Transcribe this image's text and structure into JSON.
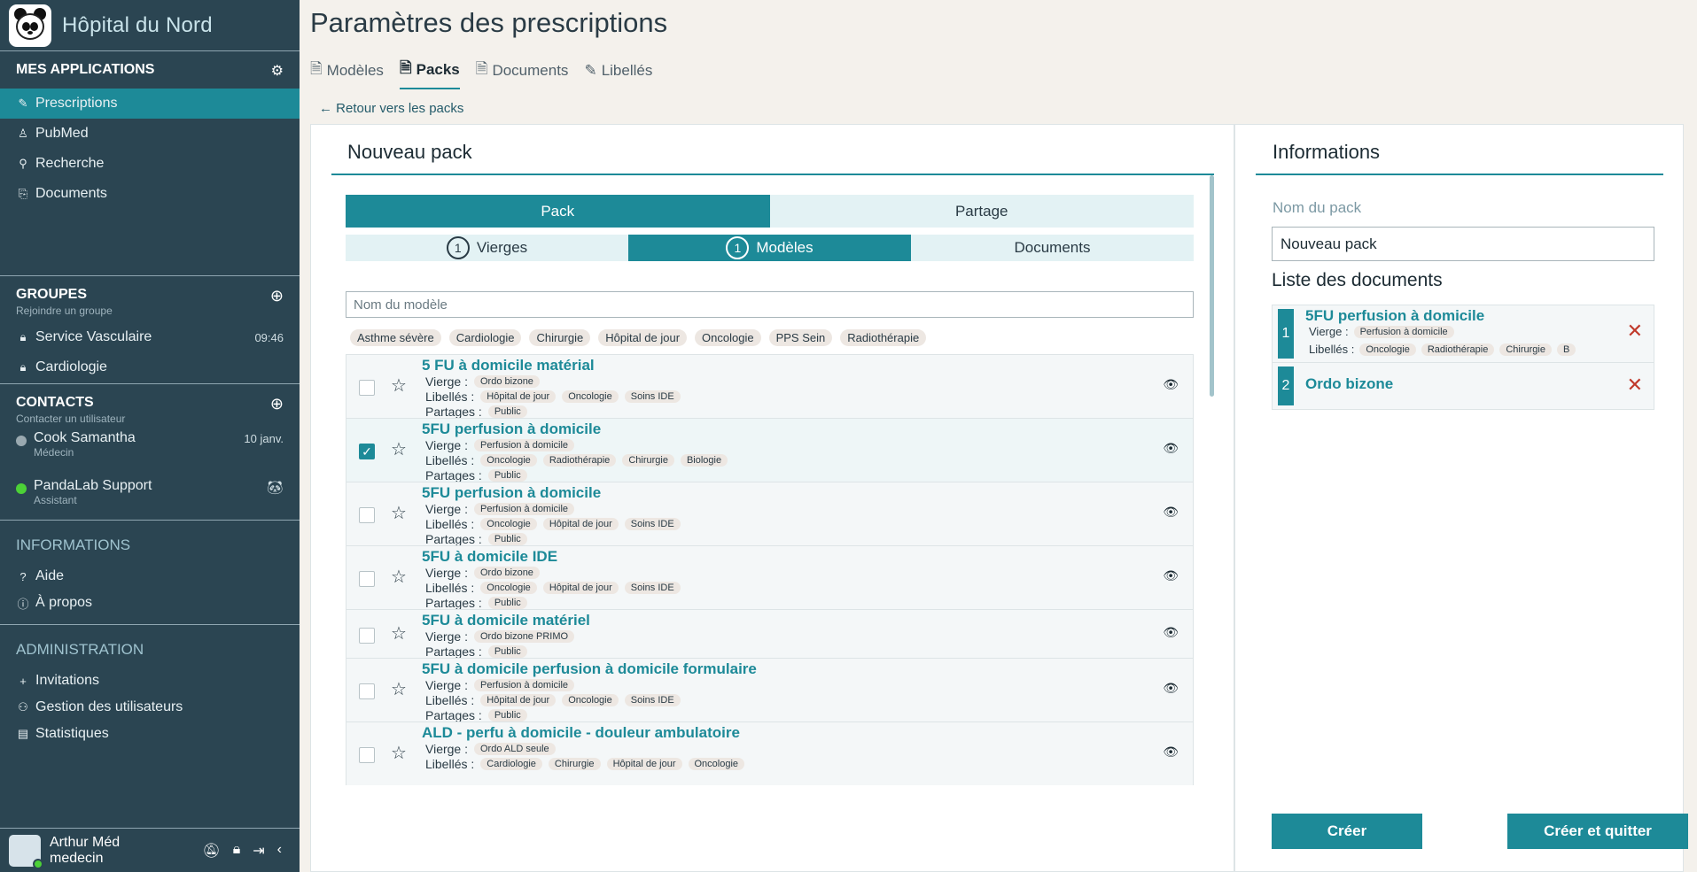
{
  "sidebar": {
    "brand": "Hôpital du Nord",
    "apps_title": "MES APPLICATIONS",
    "apps": [
      {
        "label": "Prescriptions"
      },
      {
        "label": "PubMed"
      },
      {
        "label": "Recherche"
      },
      {
        "label": "Documents"
      }
    ],
    "groups_title": "GROUPES",
    "groups_sub": "Rejoindre un groupe",
    "groups": [
      {
        "label": "Service Vasculaire",
        "time": "09:46"
      },
      {
        "label": "Cardiologie"
      }
    ],
    "contacts_title": "CONTACTS",
    "contacts_sub": "Contacter un utilisateur",
    "contacts": [
      {
        "name": "Cook Samantha",
        "role": "Médecin",
        "time": "10 janv."
      },
      {
        "name": "PandaLab Support",
        "role": "Assistant"
      }
    ],
    "info_title": "INFORMATIONS",
    "info": [
      {
        "label": "Aide"
      },
      {
        "label": "À propos"
      }
    ],
    "admin_title": "ADMINISTRATION",
    "admin": [
      {
        "label": "Invitations"
      },
      {
        "label": "Gestion des utilisateurs"
      },
      {
        "label": "Statistiques"
      }
    ],
    "user": {
      "name": "Arthur Méd",
      "role": "medecin"
    }
  },
  "header": {
    "title": "Paramètres des prescriptions",
    "tabs": [
      {
        "label": "Modèles"
      },
      {
        "label": "Packs"
      },
      {
        "label": "Documents"
      },
      {
        "label": "Libellés"
      }
    ],
    "back": "Retour vers les packs"
  },
  "left": {
    "title": "Nouveau pack",
    "seg1": [
      "Pack",
      "Partage"
    ],
    "seg2": [
      {
        "count": "1",
        "label": "Vierges"
      },
      {
        "count": "1",
        "label": "Modèles"
      },
      {
        "label": "Documents"
      }
    ],
    "search_placeholder": "Nom du modèle",
    "filters": [
      "Asthme sévère",
      "Cardiologie",
      "Chirurgie",
      "Hôpital de jour",
      "Oncologie",
      "PPS Sein",
      "Radiothérapie"
    ],
    "labels": {
      "vierge": "Vierge :",
      "libelles": "Libellés :",
      "partages": "Partages :"
    },
    "rows": [
      {
        "title": "5 FU à domicile matérial",
        "vierge": "Ordo bizone",
        "libelles": [
          "Hôpital de jour",
          "Oncologie",
          "Soins IDE"
        ],
        "partages": "Public",
        "checked": false
      },
      {
        "title": "5FU perfusion à domicile",
        "vierge": "Perfusion à domicile",
        "libelles": [
          "Oncologie",
          "Radiothérapie",
          "Chirurgie",
          "Biologie"
        ],
        "partages": "Public",
        "checked": true
      },
      {
        "title": "5FU perfusion à domicile",
        "vierge": "Perfusion à domicile",
        "libelles": [
          "Oncologie",
          "Hôpital de jour",
          "Soins IDE"
        ],
        "partages": "Public",
        "checked": false
      },
      {
        "title": "5FU à domicile IDE",
        "vierge": "Ordo bizone",
        "libelles": [
          "Oncologie",
          "Hôpital de jour",
          "Soins IDE"
        ],
        "partages": "Public",
        "checked": false
      },
      {
        "title": "5FU à domicile matériel",
        "vierge": "Ordo bizone PRIMO",
        "partages": "Public",
        "checked": false
      },
      {
        "title": "5FU à domicile perfusion à domicile formulaire",
        "vierge": "Perfusion à domicile",
        "libelles": [
          "Hôpital de jour",
          "Oncologie",
          "Soins IDE"
        ],
        "partages": "Public",
        "checked": false
      },
      {
        "title": "ALD - perfu à domicile - douleur ambulatoire",
        "vierge": "Ordo ALD seule",
        "libelles": [
          "Cardiologie",
          "Chirurgie",
          "Hôpital de jour",
          "Oncologie"
        ],
        "checked": false
      }
    ]
  },
  "right": {
    "title": "Informations",
    "name_label": "Nom du pack",
    "name_value": "Nouveau pack",
    "list_title": "Liste des documents",
    "docs": [
      {
        "num": "1",
        "title": "5FU perfusion à domicile",
        "vierge_label": "Vierge :",
        "vierge": "Perfusion à domicile",
        "libelles_label": "Libellés :",
        "libelles": [
          "Oncologie",
          "Radiothérapie",
          "Chirurgie",
          "B"
        ]
      },
      {
        "num": "2",
        "title": "Ordo bizone"
      }
    ],
    "btn_create": "Créer",
    "btn_create_quit": "Créer et quitter"
  },
  "colors": {
    "sidebar": "#2b4552",
    "accent": "#1d8a98",
    "danger": "#c0392b"
  }
}
